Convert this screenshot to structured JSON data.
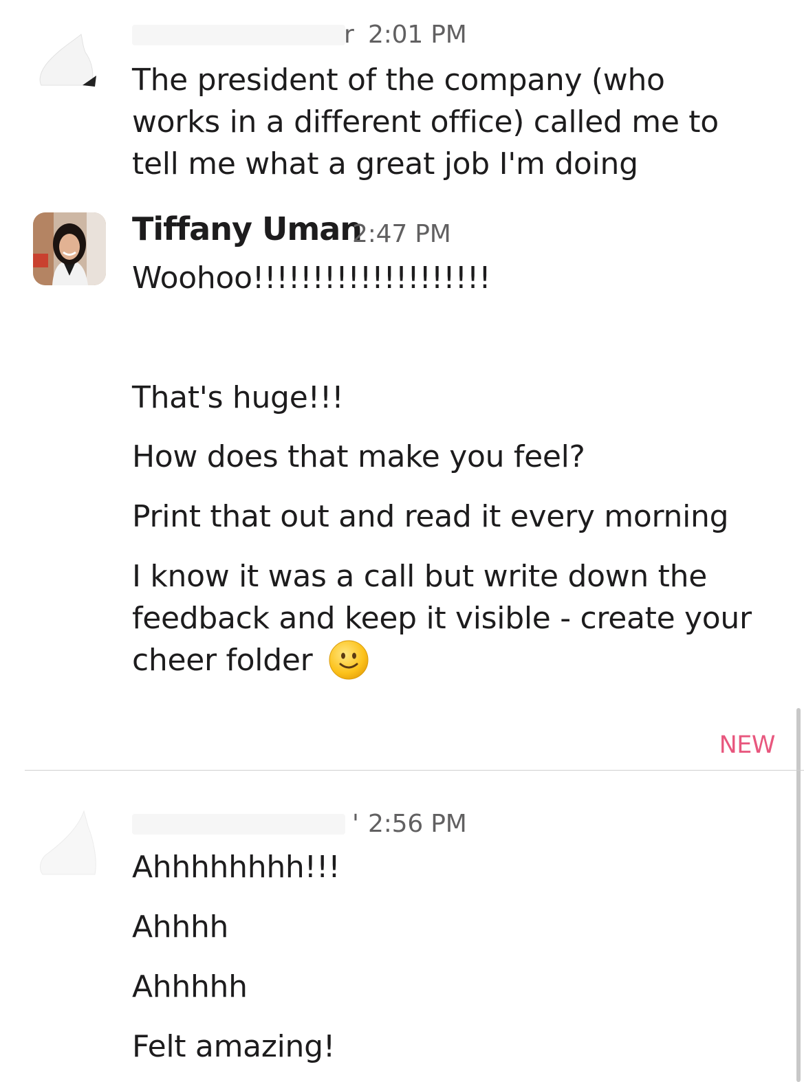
{
  "messages": [
    {
      "author": "",
      "timestamp_prefix": "r",
      "timestamp": "2:01 PM",
      "lines": [
        "The president of the company (who",
        "works in a different office) called me to",
        "tell me what a great job I'm doing"
      ]
    },
    {
      "author": "Tiffany Uman",
      "timestamp": "2:47 PM",
      "lines": [
        "Woohoo!!!!!!!!!!!!!!!!!!!!",
        "That's huge!!!",
        "How does that make you feel?",
        "Print that out and read it every morning",
        "I know it was a call but write down the",
        "feedback and keep it visible - create your",
        "cheer folder"
      ],
      "emoji": "slightly-smiling-face"
    },
    {
      "author": "",
      "timestamp_prefix": "'",
      "timestamp": "2:56 PM",
      "lines": [
        "Ahhhhhhhh!!!",
        "Ahhhh",
        "Ahhhhh",
        "Felt amazing!"
      ]
    }
  ],
  "new_divider_label": "NEW",
  "colors": {
    "new_accent": "#e8577e",
    "text": "#1d1c1d",
    "timestamp": "#616061"
  }
}
